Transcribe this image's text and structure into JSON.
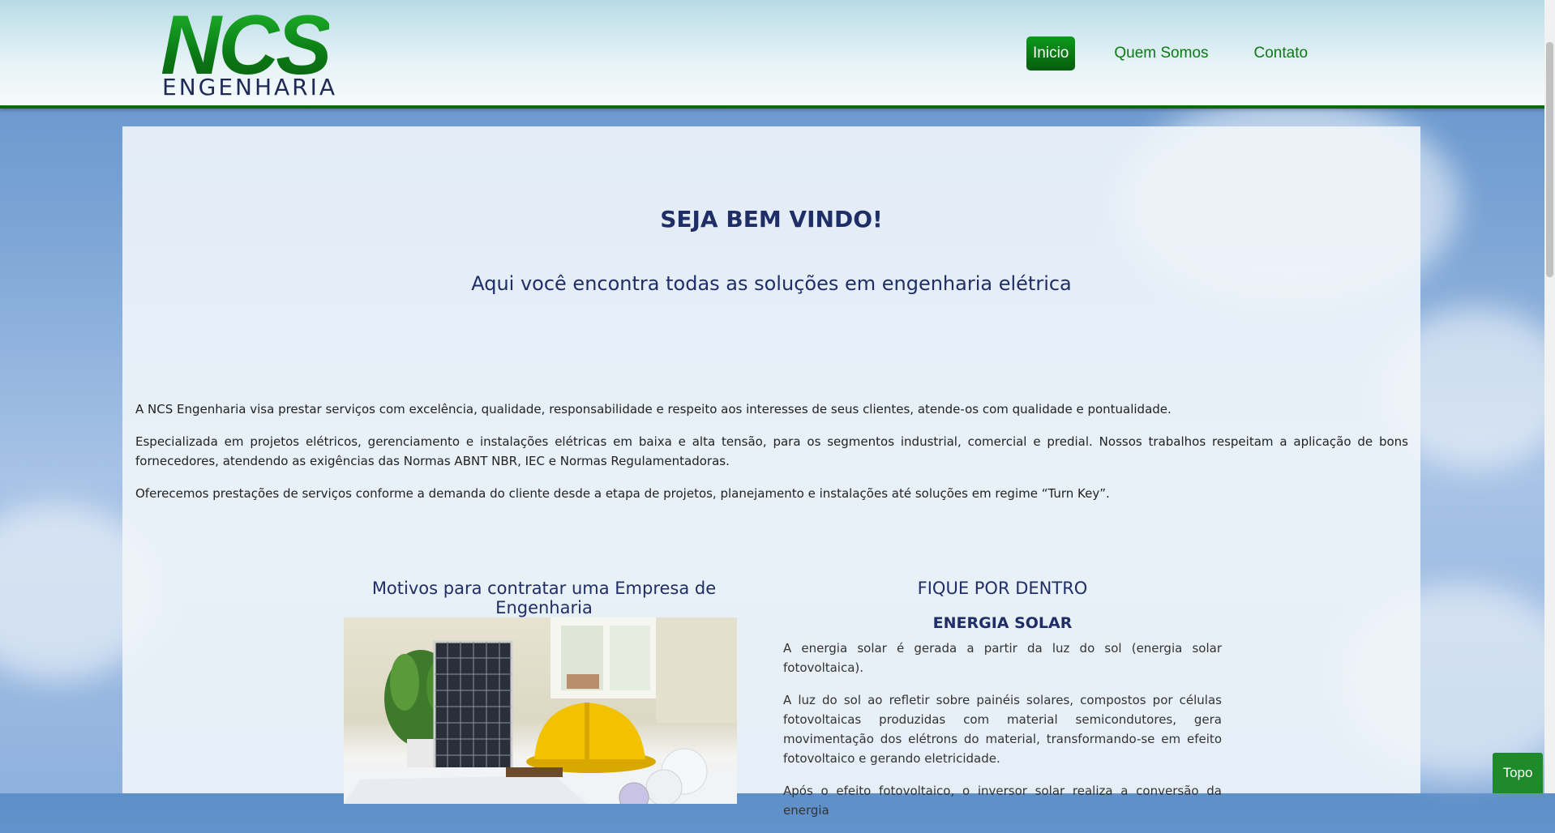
{
  "header": {
    "logo_main": "NCS",
    "logo_sub": "ENGENHARIA",
    "nav": [
      {
        "label": "Inicio",
        "active": true
      },
      {
        "label": "Quem Somos",
        "active": false
      },
      {
        "label": "Contato",
        "active": false
      }
    ]
  },
  "main": {
    "welcome": "SEJA BEM VINDO!",
    "subtitle": "Aqui você encontra todas as soluções em engenharia elétrica",
    "intro": [
      "A NCS Engenharia visa prestar serviços com excelência, qualidade, responsabilidade e respeito aos interesses de seus clientes, atende-os com qualidade e pontualidade.",
      "Especializada em projetos elétricos, gerenciamento e instalações elétricas em baixa e alta tensão, para os segmentos industrial, comercial e predial. Nossos trabalhos respeitam a aplicação de bons fornecedores, atendendo as exigências das Normas ABNT NBR, IEC e Normas Regulamentadoras.",
      "Oferecemos prestações de serviços conforme a demanda do cliente desde a etapa de projetos, planejamento e instalações até soluções em regime “Turn Key”."
    ],
    "left": {
      "heading": "Motivos para contratar uma Empresa de Engenharia"
    },
    "right": {
      "heading": "FIQUE POR DENTRO",
      "subheading": "ENERGIA SOLAR",
      "paragraphs": [
        "A energia solar é gerada a partir da luz do sol (energia solar fotovoltaica).",
        "A luz do sol ao refletir sobre painéis solares, compostos por células fotovoltaicas produzidas com material semicondutores, gera movimentação dos elétrons do material, transformando-se em efeito fotovoltaico e gerando eletricidade.",
        "Após o efeito fotovoltaico, o inversor solar realiza a conversão da energia"
      ]
    }
  },
  "top_button": "Topo",
  "colors": {
    "brand_green": "#0b7a14",
    "heading_navy": "#1f2e66"
  }
}
